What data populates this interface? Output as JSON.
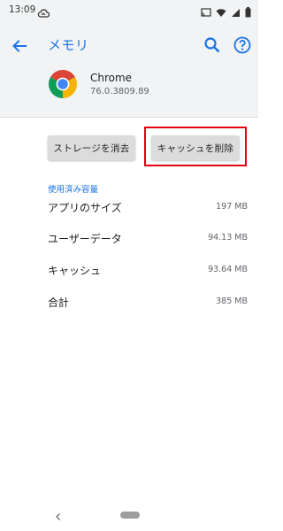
{
  "status_bar": {
    "time": "13:09"
  },
  "app_bar": {
    "title": "メモリ"
  },
  "app_info": {
    "name": "Chrome",
    "version": "76.0.3809.89"
  },
  "buttons": {
    "clear_storage": "ストレージを消去",
    "clear_cache": "キャッシュを削除"
  },
  "usage": {
    "header": "使用済み容量",
    "rows": [
      {
        "label": "アプリのサイズ",
        "value": "197 MB"
      },
      {
        "label": "ユーザーデータ",
        "value": "94.13 MB"
      },
      {
        "label": "キャッシュ",
        "value": "93.64 MB"
      },
      {
        "label": "合計",
        "value": "385 MB"
      }
    ]
  },
  "colors": {
    "accent": "#1a73e8",
    "highlight": "#e60012",
    "header_bg": "#f1f3f4"
  }
}
